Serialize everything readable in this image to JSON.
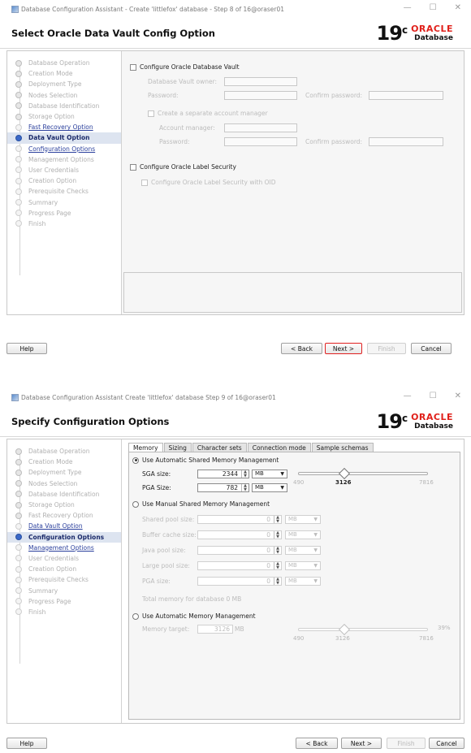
{
  "window1": {
    "title": "Database Configuration Assistant - Create 'littlefox' database - Step 8 of 16@oraser01",
    "header": "Select Oracle Data Vault Config Option",
    "nav": [
      {
        "label": "Database Operation",
        "state": "done"
      },
      {
        "label": "Creation Mode",
        "state": "done"
      },
      {
        "label": "Deployment Type",
        "state": "done"
      },
      {
        "label": "Nodes Selection",
        "state": "done"
      },
      {
        "label": "Database Identification",
        "state": "done"
      },
      {
        "label": "Storage Option",
        "state": "done"
      },
      {
        "label": "Fast Recovery Option",
        "state": "link"
      },
      {
        "label": "Data Vault Option",
        "state": "current"
      },
      {
        "label": "Configuration Options",
        "state": "link"
      },
      {
        "label": "Management Options",
        "state": "pending"
      },
      {
        "label": "User Credentials",
        "state": "pending"
      },
      {
        "label": "Creation Option",
        "state": "pending"
      },
      {
        "label": "Prerequisite Checks",
        "state": "pending"
      },
      {
        "label": "Summary",
        "state": "pending"
      },
      {
        "label": "Progress Page",
        "state": "pending"
      },
      {
        "label": "Finish",
        "state": "pending"
      }
    ],
    "configure_vault": "Configure Oracle Database Vault",
    "vault_owner": "Database Vault owner:",
    "password": "Password:",
    "confirm_password": "Confirm password:",
    "separate_manager": "Create a separate account manager",
    "account_manager": "Account manager:",
    "password2": "Password:",
    "confirm_password2": "Confirm password:",
    "label_security": "Configure Oracle Label Security",
    "label_security_oid": "Configure Oracle Label Security with OID"
  },
  "window2": {
    "title": "Database Configuration Assistant  Create 'littlefox' database  Step 9 of 16@oraser01",
    "header": "Specify Configuration Options",
    "nav": [
      {
        "label": "Database Operation",
        "state": "done"
      },
      {
        "label": "Creation Mode",
        "state": "done"
      },
      {
        "label": "Deployment Type",
        "state": "done"
      },
      {
        "label": "Nodes Selection",
        "state": "done"
      },
      {
        "label": "Database Identification",
        "state": "done"
      },
      {
        "label": "Storage Option",
        "state": "done"
      },
      {
        "label": "Fast Recovery Option",
        "state": "done"
      },
      {
        "label": "Data Vault Option",
        "state": "link"
      },
      {
        "label": "Configuration Options",
        "state": "current"
      },
      {
        "label": "Management Options",
        "state": "link"
      },
      {
        "label": "User Credentials",
        "state": "pending"
      },
      {
        "label": "Creation Option",
        "state": "pending"
      },
      {
        "label": "Prerequisite Checks",
        "state": "pending"
      },
      {
        "label": "Summary",
        "state": "pending"
      },
      {
        "label": "Progress Page",
        "state": "pending"
      },
      {
        "label": "Finish",
        "state": "pending"
      }
    ],
    "tabs": [
      "Memory",
      "Sizing",
      "Character sets",
      "Connection mode",
      "Sample schemas"
    ],
    "auto_shared": "Use Automatic Shared Memory Management",
    "sga_label": "SGA size:",
    "sga_value": "2344",
    "pga_label": "PGA Size:",
    "pga_value": "782",
    "unit": "MB",
    "slider_min": "490",
    "slider_value": "3126",
    "slider_max": "7816",
    "manual_shared": "Use Manual Shared Memory Management",
    "manual_rows": [
      {
        "label": "Shared pool size:",
        "value": "0"
      },
      {
        "label": "Buffer cache size:",
        "value": "0"
      },
      {
        "label": "Java pool size:",
        "value": "0"
      },
      {
        "label": "Large pool size:",
        "value": "0"
      },
      {
        "label": "PGA size:",
        "value": "0"
      }
    ],
    "total_memory": "Total memory for database 0 MB",
    "auto_memory": "Use Automatic Memory Management",
    "memory_target_label": "Memory target:",
    "memory_target_value": "3126",
    "slider2_min": "490",
    "slider2_value": "3126",
    "slider2_max": "7816",
    "slider2_pct": "39%"
  },
  "buttons": {
    "help": "Help",
    "back": "< Back",
    "next": "Next >",
    "finish": "Finish",
    "cancel": "Cancel"
  }
}
